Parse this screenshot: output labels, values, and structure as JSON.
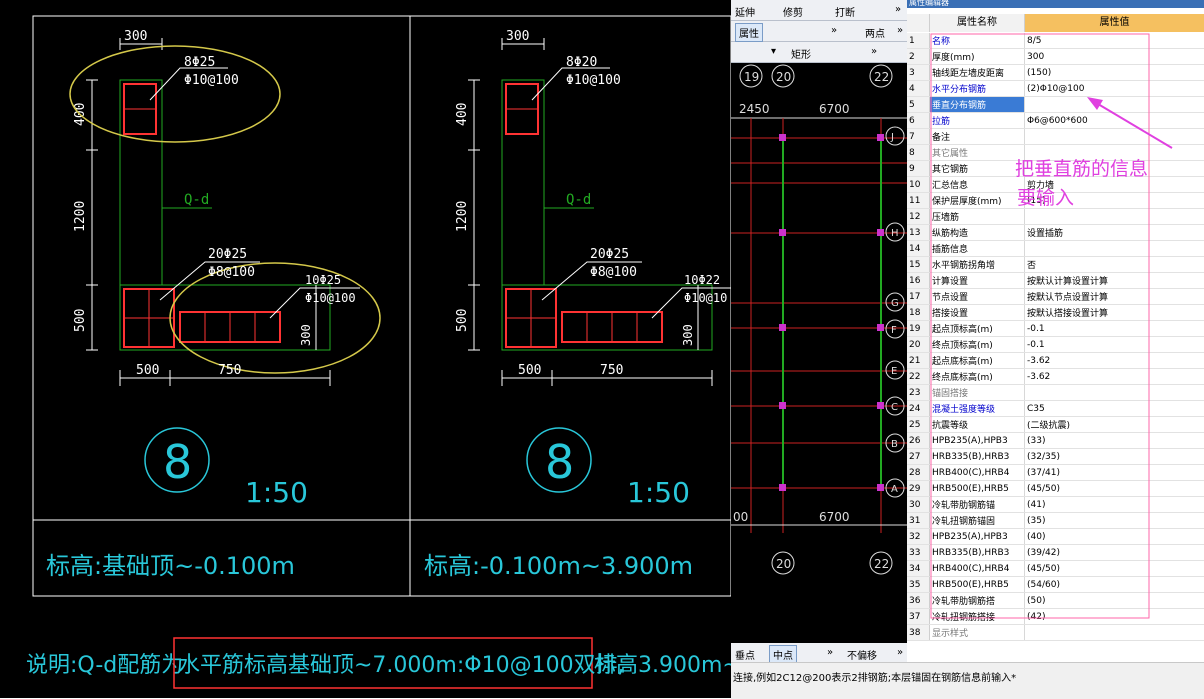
{
  "cad": {
    "left": {
      "dims": [
        "300",
        "400",
        "1200",
        "500",
        "500",
        "750",
        "300"
      ],
      "rebar": [
        "8Φ25",
        "Φ10@100",
        "20Φ25",
        "Φ8@100",
        "10Φ25",
        "Φ10@100"
      ],
      "wall": "Q-d",
      "number": "8",
      "scale": "1:50",
      "elevation": "标高:基础顶~-0.100m"
    },
    "right": {
      "dims": [
        "300",
        "400",
        "1200",
        "500",
        "500",
        "750",
        "300"
      ],
      "rebar": [
        "8Φ20",
        "Φ10@100",
        "20Φ25",
        "Φ8@100",
        "10Φ22",
        "Φ10@10"
      ],
      "wall": "Q-d",
      "number": "8",
      "scale": "1:50",
      "elevation": "标高:-0.100m~3.900m"
    },
    "note": {
      "prefix": "说明:Q-d配筋为",
      "highlight": "水平筋标高基础顶~7.000m:Φ10@100双排,",
      "suffix": "标高3.900m~"
    }
  },
  "mid": {
    "toolbar1": [
      "延伸",
      "修剪",
      "打断",
      "»"
    ],
    "toolbar2": [
      "属性",
      "»",
      "两点",
      "»"
    ],
    "toolbar3": [
      "矩形",
      "»"
    ],
    "axis_top": [
      "19",
      "20",
      "22"
    ],
    "dims_top": [
      "2450",
      "6700"
    ],
    "axis_rows": [
      "J",
      "H",
      "G",
      "F",
      "E",
      "C",
      "B",
      "A"
    ],
    "dim_bottom": [
      "00",
      "6700"
    ],
    "axis_bottom": [
      "20",
      "22"
    ],
    "bottombar": [
      "垂点",
      "中点",
      "»",
      "不偏移",
      "»"
    ]
  },
  "grid": {
    "title": "属性编辑器",
    "col_name": "属性名称",
    "col_value": "属性值",
    "rows": [
      {
        "n": "1",
        "name": "名称",
        "value": "8/5",
        "style": "blue"
      },
      {
        "n": "2",
        "name": "厚度(mm)",
        "value": "300",
        "style": ""
      },
      {
        "n": "3",
        "name": "轴线距左墙皮距离",
        "value": "(150)",
        "style": ""
      },
      {
        "n": "4",
        "name": "水平分布钢筋",
        "value": "(2)Φ10@100",
        "style": "blue"
      },
      {
        "n": "5",
        "name": "垂直分布钢筋",
        "value": "",
        "style": "sel"
      },
      {
        "n": "6",
        "name": "拉筋",
        "value": "Φ6@600*600",
        "style": "blue"
      },
      {
        "n": "7",
        "name": "备注",
        "value": "",
        "style": ""
      },
      {
        "n": "8",
        "name": "其它属性",
        "value": "",
        "style": "grp"
      },
      {
        "n": "9",
        "name": "其它钢筋",
        "value": "",
        "style": ""
      },
      {
        "n": "10",
        "name": "汇总信息",
        "value": "剪力墙",
        "style": ""
      },
      {
        "n": "11",
        "name": "保护层厚度(mm)",
        "value": "(15)",
        "style": ""
      },
      {
        "n": "12",
        "name": "压墙筋",
        "value": "",
        "style": ""
      },
      {
        "n": "13",
        "name": "纵筋构造",
        "value": "设置插筋",
        "style": ""
      },
      {
        "n": "14",
        "name": "插筋信息",
        "value": "",
        "style": ""
      },
      {
        "n": "15",
        "name": "水平钢筋拐角增",
        "value": "否",
        "style": ""
      },
      {
        "n": "16",
        "name": "计算设置",
        "value": "按默认计算设置计算",
        "style": ""
      },
      {
        "n": "17",
        "name": "节点设置",
        "value": "按默认节点设置计算",
        "style": ""
      },
      {
        "n": "18",
        "name": "搭接设置",
        "value": "按默认搭接设置计算",
        "style": ""
      },
      {
        "n": "19",
        "name": "起点顶标高(m)",
        "value": "-0.1",
        "style": ""
      },
      {
        "n": "20",
        "name": "终点顶标高(m)",
        "value": "-0.1",
        "style": ""
      },
      {
        "n": "21",
        "name": "起点底标高(m)",
        "value": "-3.62",
        "style": ""
      },
      {
        "n": "22",
        "name": "终点底标高(m)",
        "value": "-3.62",
        "style": ""
      },
      {
        "n": "23",
        "name": "锚固搭接",
        "value": "",
        "style": "grp"
      },
      {
        "n": "24",
        "name": "混凝土强度等级",
        "value": "C35",
        "style": "blue"
      },
      {
        "n": "25",
        "name": "抗震等级",
        "value": "(二级抗震)",
        "style": ""
      },
      {
        "n": "26",
        "name": "HPB235(A),HPB3",
        "value": "(33)",
        "style": ""
      },
      {
        "n": "27",
        "name": "HRB335(B),HRB3",
        "value": "(32/35)",
        "style": ""
      },
      {
        "n": "28",
        "name": "HRB400(C),HRB4",
        "value": "(37/41)",
        "style": ""
      },
      {
        "n": "29",
        "name": "HRB500(E),HRB5",
        "value": "(45/50)",
        "style": ""
      },
      {
        "n": "30",
        "name": "冷轧带肋钢筋锚",
        "value": "(41)",
        "style": ""
      },
      {
        "n": "31",
        "name": "冷轧扭钢筋锚固",
        "value": "(35)",
        "style": ""
      },
      {
        "n": "32",
        "name": "HPB235(A),HPB3",
        "value": "(40)",
        "style": ""
      },
      {
        "n": "33",
        "name": "HRB335(B),HRB3",
        "value": "(39/42)",
        "style": ""
      },
      {
        "n": "34",
        "name": "HRB400(C),HRB4",
        "value": "(45/50)",
        "style": ""
      },
      {
        "n": "35",
        "name": "HRB500(E),HRB5",
        "value": "(54/60)",
        "style": ""
      },
      {
        "n": "36",
        "name": "冷轧带肋钢筋搭",
        "value": "(50)",
        "style": ""
      },
      {
        "n": "37",
        "name": "冷轧扭钢筋搭接",
        "value": "(42)",
        "style": ""
      },
      {
        "n": "38",
        "name": "显示样式",
        "value": "",
        "style": "grp"
      }
    ],
    "annotation": [
      "把垂直筋的信息",
      "要输入"
    ]
  },
  "status": "连接,例如2C12@200表示2排钢筋;本层锚固在钢筋信息前输入*",
  "colors": {
    "accent": "#e040e0",
    "cadLine": "#ffffff",
    "ellipse": "#d4c84a",
    "rebar": "#ff3333",
    "frame": "#22aa22"
  }
}
